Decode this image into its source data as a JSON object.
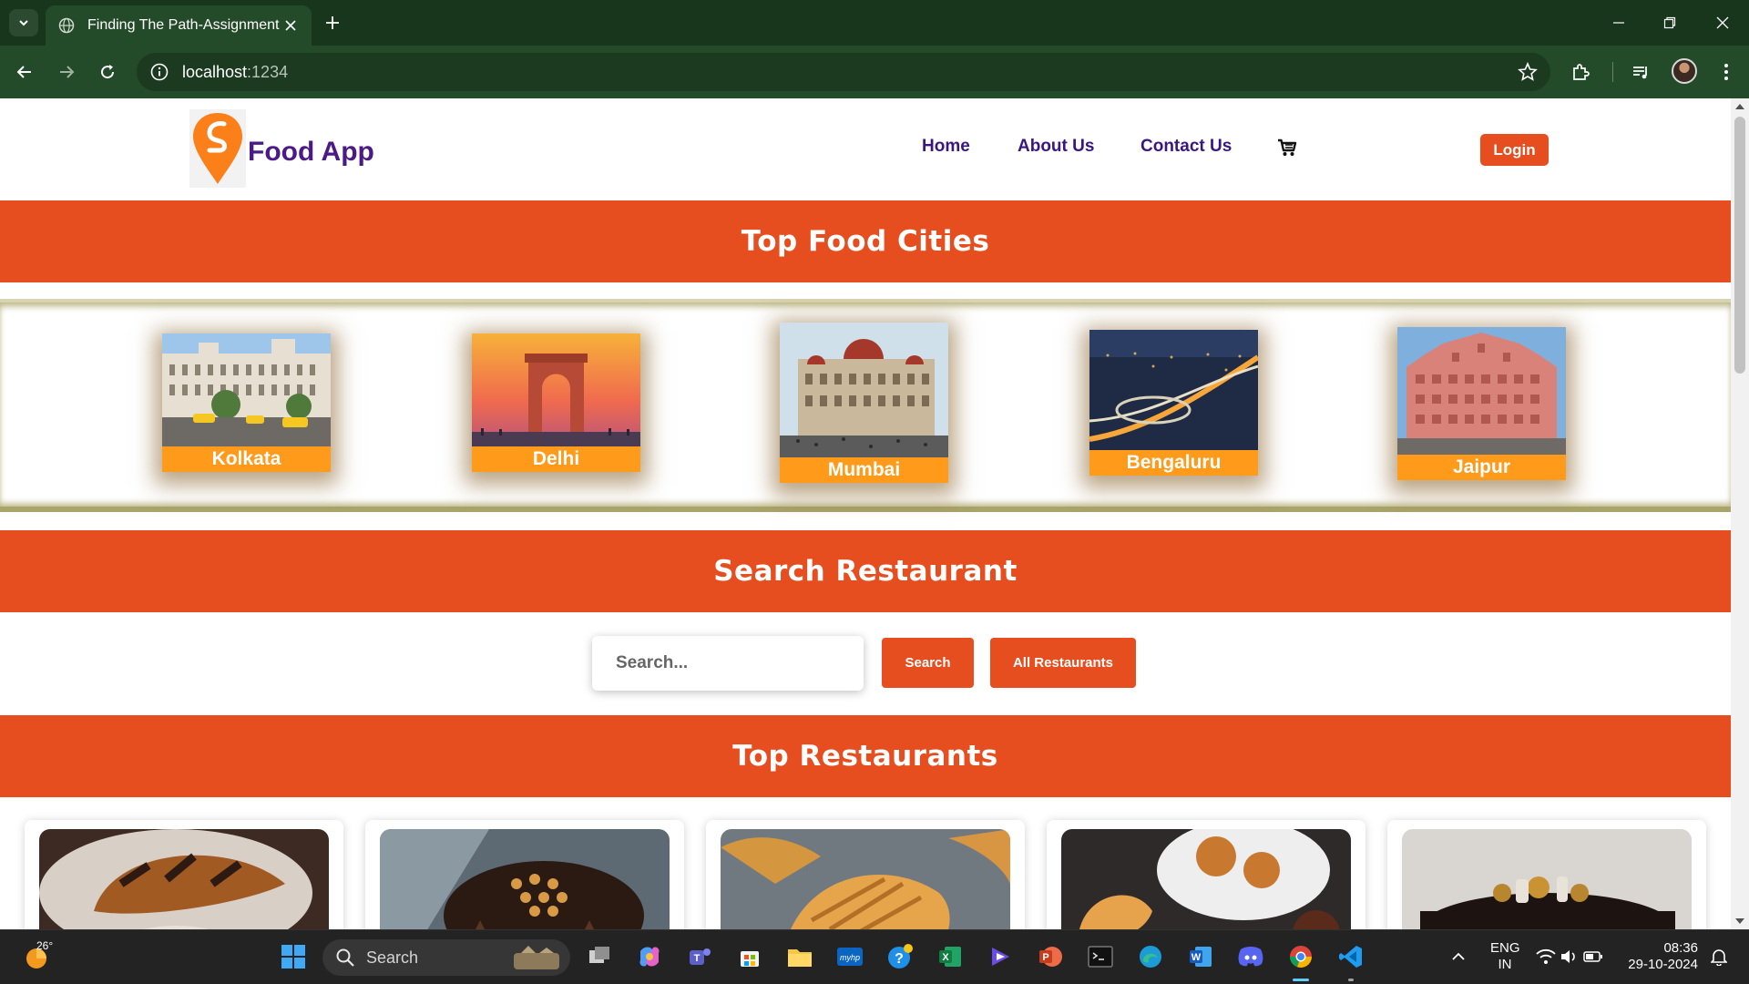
{
  "browser": {
    "tab_title": "Finding The Path-Assignment",
    "url_host": "localhost",
    "url_port": ":1234"
  },
  "header": {
    "logo_text": "Food App",
    "nav": [
      "Home",
      "About Us",
      "Contact Us"
    ],
    "login_label": "Login"
  },
  "sections": {
    "top_cities": "Top Food Cities",
    "search": "Search Restaurant",
    "top_restaurants": "Top Restaurants"
  },
  "cities": [
    "Kolkata",
    "Delhi",
    "Mumbai",
    "Bengaluru",
    "Jaipur"
  ],
  "search": {
    "placeholder": "Search...",
    "search_label": "Search",
    "all_label": "All Restaurants"
  },
  "restaurants_visible": 5,
  "taskbar": {
    "weather_temp": "26°",
    "search_label": "Search",
    "lang_line1": "ENG",
    "lang_line2": "IN",
    "time": "08:36",
    "date": "29-10-2024"
  },
  "colors": {
    "brand_orange": "#e64e1f",
    "city_label": "#ff9a1a",
    "nav_purple": "#3a1780",
    "chrome_green": "#244b29"
  }
}
